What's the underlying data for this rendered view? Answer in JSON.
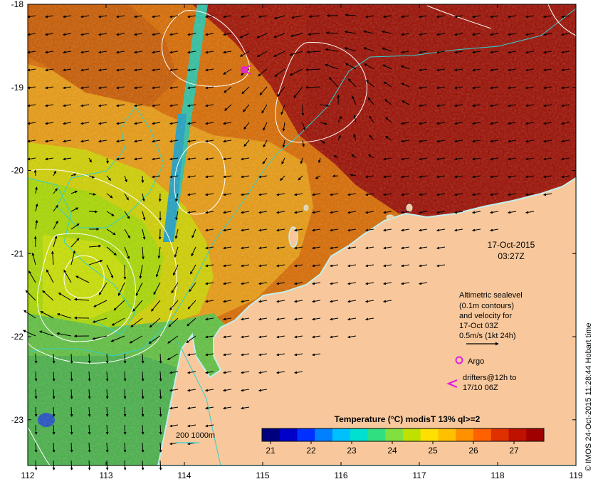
{
  "map": {
    "lon_ticks": [
      112,
      113,
      114,
      115,
      116,
      117,
      118,
      119
    ],
    "lat_ticks": [
      -18,
      -19,
      -20,
      -21,
      -22,
      -23
    ],
    "lon_range": [
      112,
      119
    ],
    "lat_range": [
      -23.55,
      -18.0
    ]
  },
  "annotations": {
    "date": "17-Oct-2015",
    "time": "03:27Z",
    "sealevel_line1": "Altimetric sealevel",
    "sealevel_line2": "(0.1m contours)",
    "sealevel_line3": "and velocity for",
    "sealevel_line4": "17-Oct 03Z",
    "velocity_scale": "0.5m/s (1kt 24h)",
    "argo_label": "Argo",
    "drifters_line1": "drifters@12h to",
    "drifters_line2": "17/10 06Z",
    "isobath_label": "200  1000m",
    "credit": "© IMOS 24-Oct-2015 11:28:44 Hobart time"
  },
  "colorbar": {
    "title": "Temperature (°C) modisT 13% ql>=2",
    "ticks": [
      "21",
      "22",
      "23",
      "24",
      "25",
      "26",
      "27"
    ],
    "colors": [
      "#00007f",
      "#0000c8",
      "#0030ff",
      "#0080ff",
      "#00c0ff",
      "#00e0d0",
      "#30e080",
      "#80e040",
      "#c0e000",
      "#ffe000",
      "#ffc000",
      "#ff9000",
      "#ff6000",
      "#e03000",
      "#c01000",
      "#a00000"
    ]
  },
  "colors": {
    "land": "#f8c89c",
    "coast": "#c0f0f0",
    "contour": "#ffffff",
    "isobath": "#30d0d0",
    "argo": "#e020e0"
  },
  "icons": {
    "argo_marker": "circle",
    "drifter_marker": "chevron-left"
  }
}
